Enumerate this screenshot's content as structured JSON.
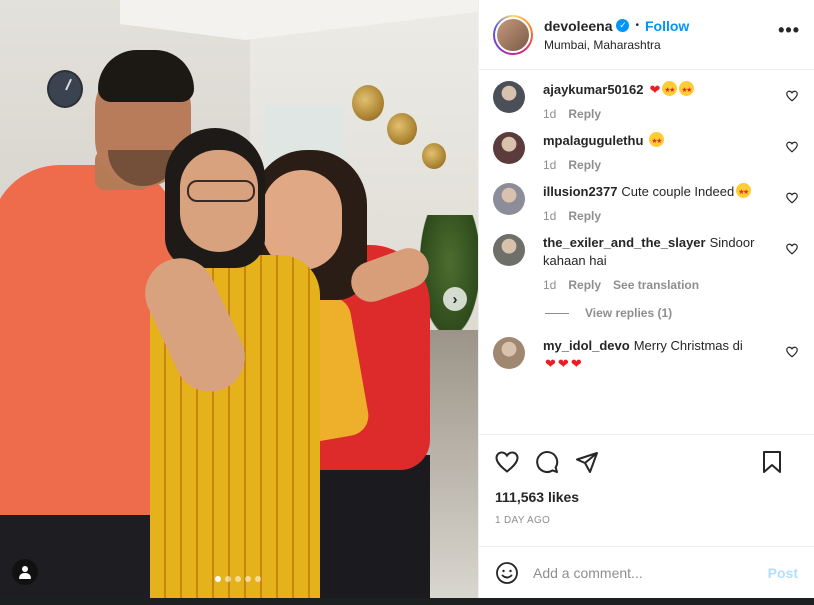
{
  "post": {
    "username": "devoleena",
    "location": "Mumbai, Maharashtra",
    "follow_label": "Follow",
    "more_label": "•••",
    "separator": "•"
  },
  "carousel": {
    "next_label": "›",
    "slide_count": 5,
    "active_slide": 1
  },
  "comments": [
    {
      "user": "ajaykumar50162",
      "text": "",
      "emoji": [
        "heart",
        "star",
        "star"
      ],
      "time": "1d",
      "reply": "Reply",
      "avatar_color": "#4a4f58"
    },
    {
      "user": "mpalagugulethu",
      "text": "",
      "emoji": [
        "star"
      ],
      "time": "1d",
      "reply": "Reply",
      "avatar_color": "#5b3b3b"
    },
    {
      "user": "illusion2377",
      "text": "Cute couple Indeed",
      "emoji": [
        "star"
      ],
      "time": "1d",
      "reply": "Reply",
      "avatar_color": "#8c8d99"
    },
    {
      "user": "the_exiler_and_the_slayer",
      "text": "Sindoor kahaan hai",
      "emoji": [],
      "time": "1d",
      "reply": "Reply",
      "translate": "See translation",
      "avatar_color": "#6f6f6a"
    },
    {
      "user": "my_idol_devo",
      "text": "Merry Christmas di",
      "emoji": [
        "heart",
        "heart",
        "heart"
      ],
      "time": "",
      "reply": "",
      "avatar_color": "#a08770"
    }
  ],
  "view_replies": "View replies (1)",
  "actions": {
    "likes": "111,563 likes",
    "date": "1 DAY AGO"
  },
  "composer": {
    "placeholder": "Add a comment...",
    "post_label": "Post"
  },
  "colors": {
    "accent": "#0095f6",
    "heart": "#ed1c24",
    "muted": "#8e8e8e"
  }
}
